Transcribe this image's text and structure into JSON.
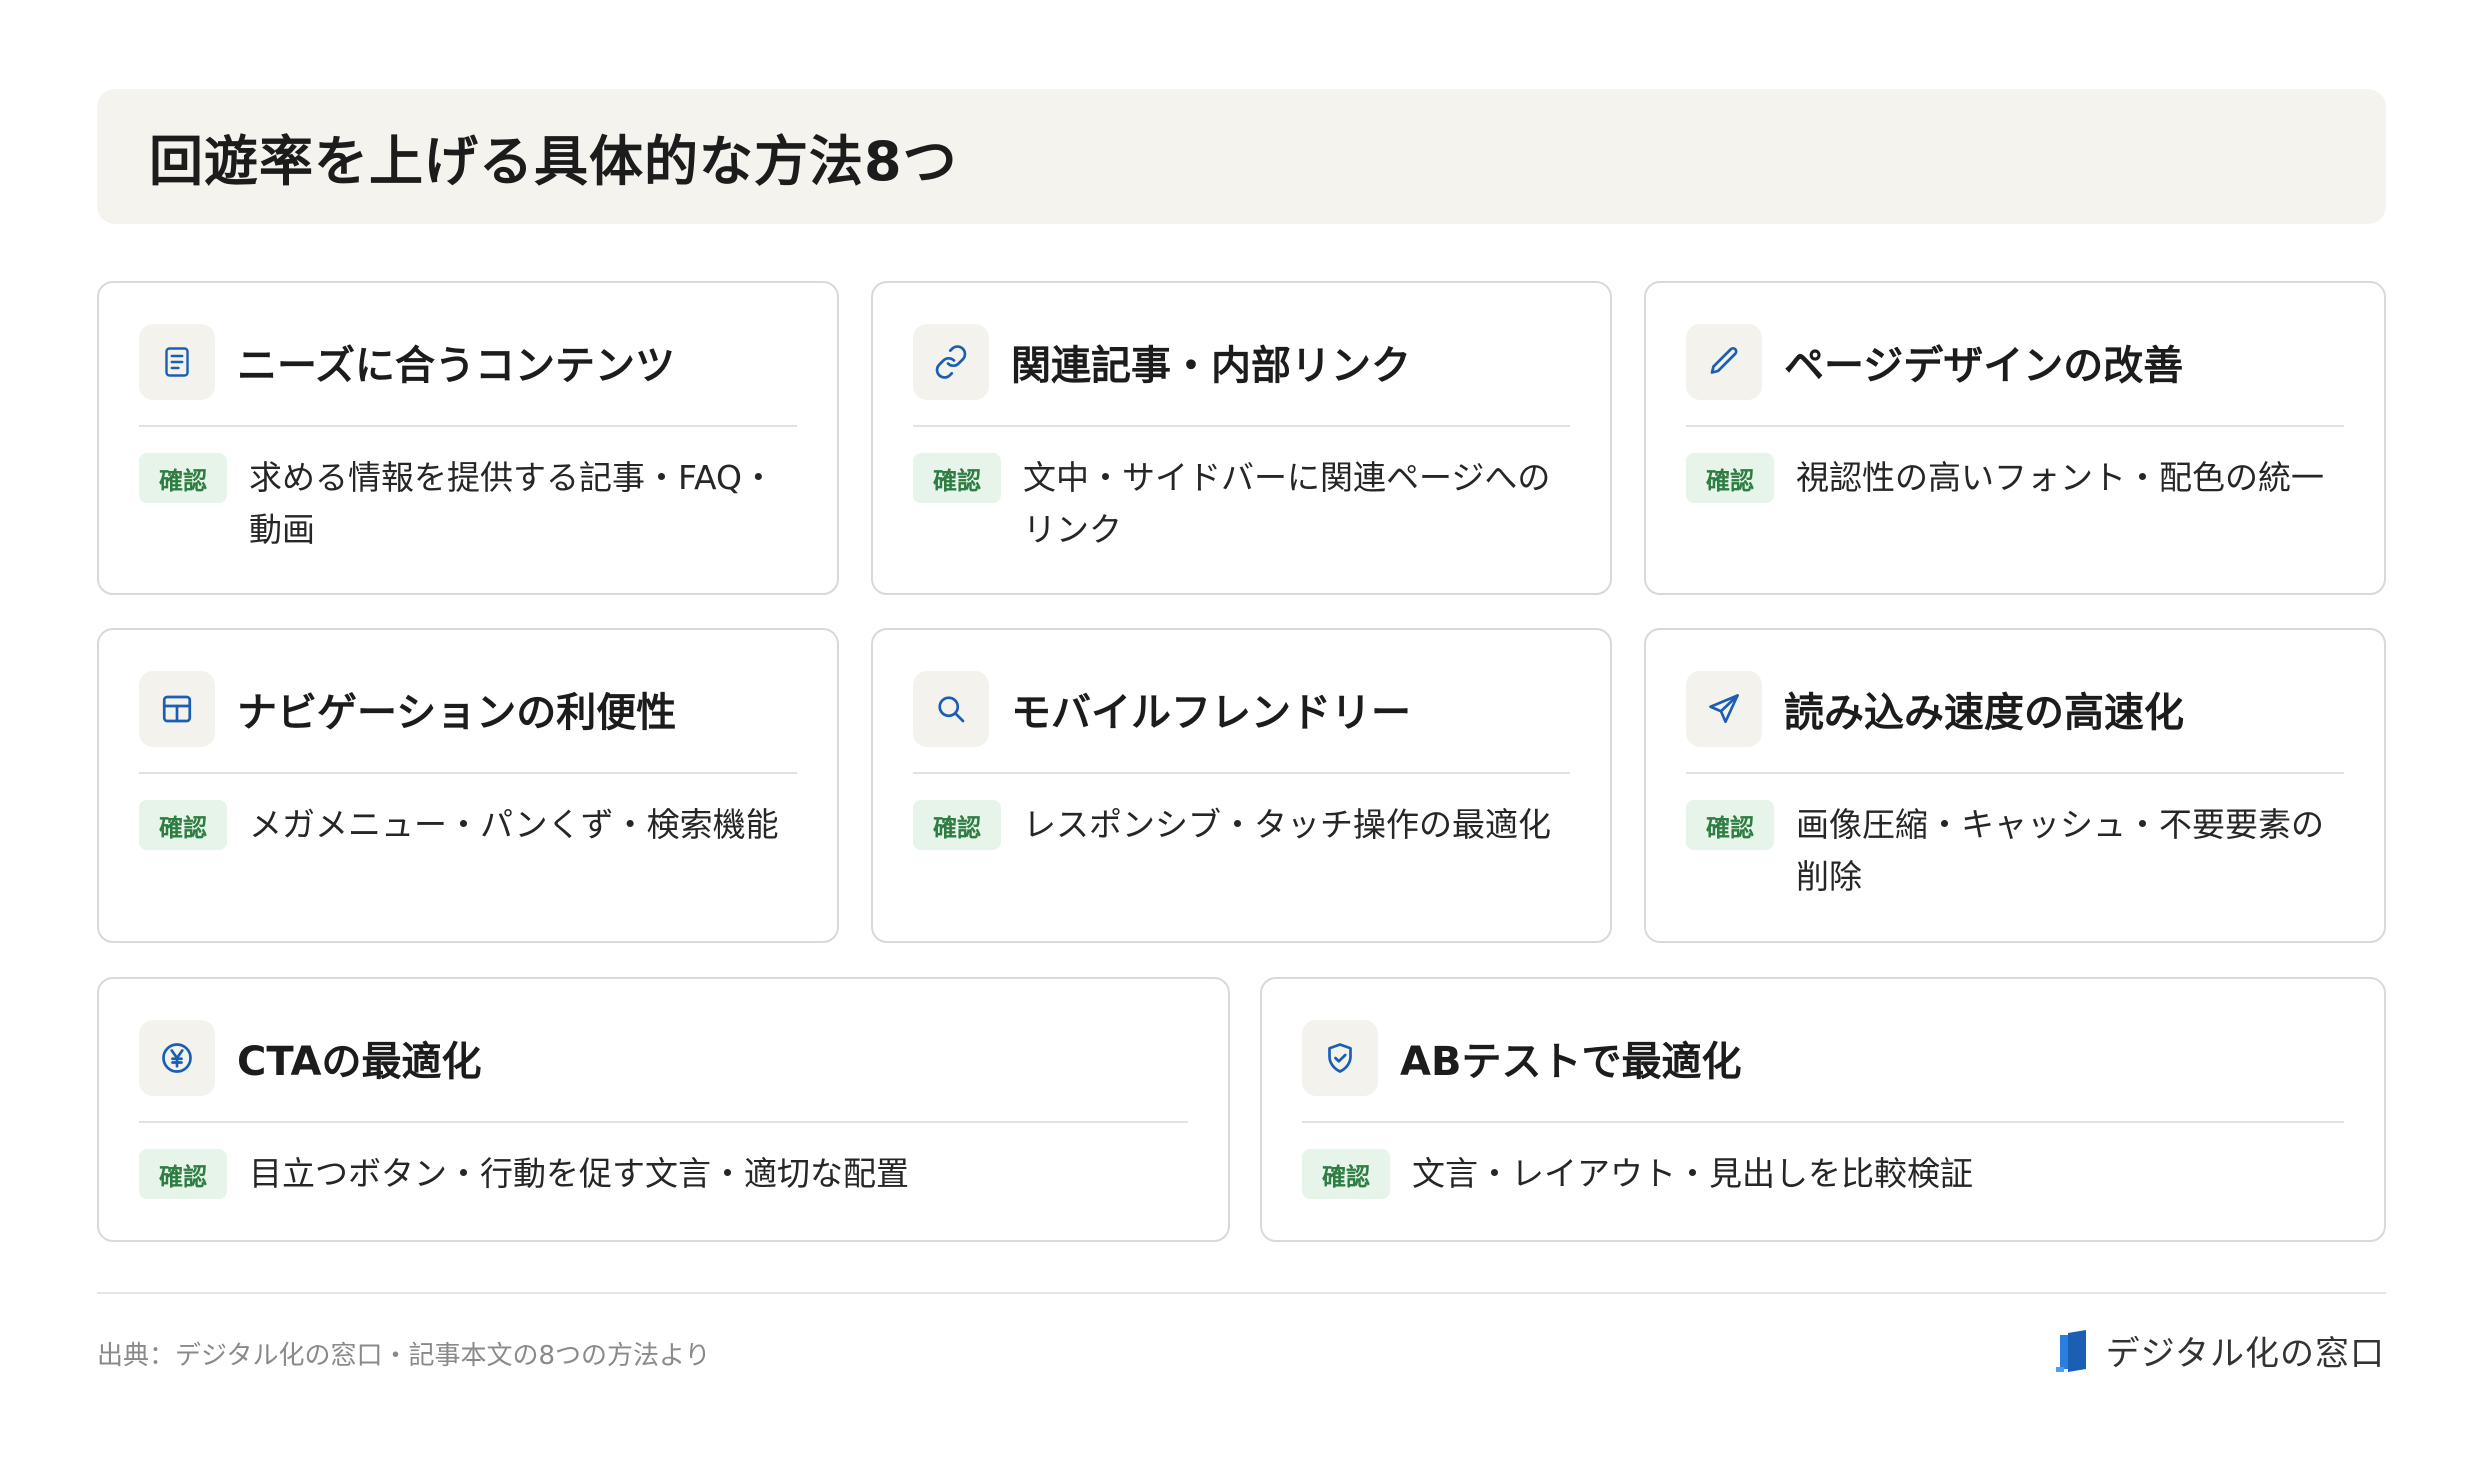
{
  "title": "回遊率を上げる具体的な方法8つ",
  "badge_label": "確認",
  "cards": [
    {
      "title": "ニーズに合うコンテンツ",
      "icon": "document-icon",
      "text": "求める情報を提供する記事・FAQ・動画"
    },
    {
      "title": "関連記事・内部リンク",
      "icon": "link-icon",
      "text": "文中・サイドバーに関連ページへのリンク"
    },
    {
      "title": "ページデザインの改善",
      "icon": "pencil-icon",
      "text": "視認性の高いフォント・配色の統一"
    },
    {
      "title": "ナビゲーションの利便性",
      "icon": "layout-icon",
      "text": "メガメニュー・パンくず・検索機能"
    },
    {
      "title": "モバイルフレンドリー",
      "icon": "search-icon",
      "text": "レスポンシブ・タッチ操作の最適化"
    },
    {
      "title": "読み込み速度の高速化",
      "icon": "send-icon",
      "text": "画像圧縮・キャッシュ・不要要素の削除"
    },
    {
      "title": "CTAの最適化",
      "icon": "yen-icon",
      "text": "目立つボタン・行動を促す文言・適切な配置"
    },
    {
      "title": "ABテストで最適化",
      "icon": "shield-check-icon",
      "text": "文言・レイアウト・見出しを比較検証"
    }
  ],
  "footer": {
    "source": "出典：デジタル化の窓口・記事本文の8つの方法より",
    "brand": "デジタル化の窓口"
  },
  "colors": {
    "accent": "#1a5fb4",
    "badge_bg": "#e6f4e9",
    "badge_text": "#2e7d43",
    "title_bg": "#f5f3ee"
  }
}
